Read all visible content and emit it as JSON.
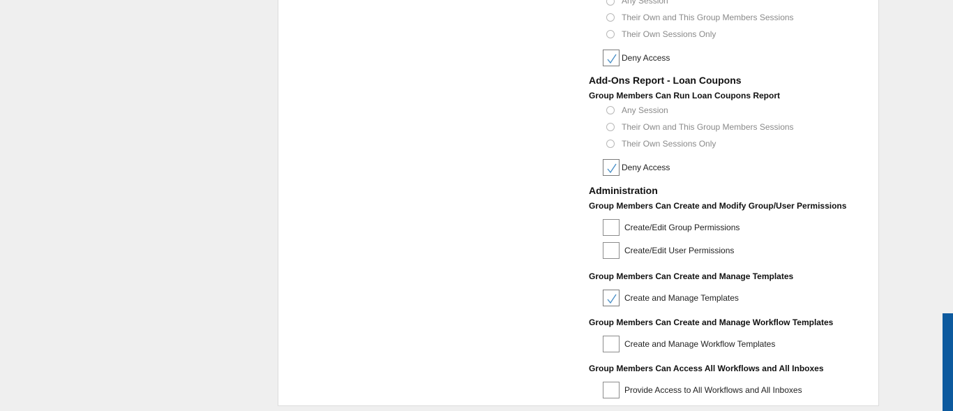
{
  "deny_group_1": {
    "options": [
      "Any Session",
      "Their Own and This Group Members Sessions",
      "Their Own Sessions Only"
    ],
    "deny_label": "Deny Access",
    "deny_checked": true
  },
  "loan_coupons": {
    "title": "Add-Ons Report - Loan Coupons",
    "label": "Group Members Can Run Loan Coupons Report",
    "options": [
      "Any Session",
      "Their Own and This Group Members Sessions",
      "Their Own Sessions Only"
    ],
    "deny_label": "Deny Access",
    "deny_checked": true
  },
  "administration": {
    "title": "Administration",
    "permissions": {
      "label": "Group Members Can Create and Modify Group/User Permissions",
      "items": [
        {
          "label": "Create/Edit Group Permissions",
          "checked": false
        },
        {
          "label": "Create/Edit User Permissions",
          "checked": false
        }
      ]
    },
    "templates": {
      "label": "Group Members Can Create and Manage Templates",
      "items": [
        {
          "label": "Create and Manage Templates",
          "checked": true
        }
      ]
    },
    "workflow_templates": {
      "label": "Group Members Can Create and Manage Workflow Templates",
      "items": [
        {
          "label": "Create and Manage Workflow Templates",
          "checked": false
        }
      ]
    },
    "workflows_inboxes": {
      "label": "Group Members Can Access All Workflows and All Inboxes",
      "items": [
        {
          "label": "Provide Access to All Workflows and All Inboxes",
          "checked": false
        }
      ]
    }
  },
  "colors": {
    "check_mark": "#4a90c8",
    "accent_bar": "#0d5a9e"
  }
}
